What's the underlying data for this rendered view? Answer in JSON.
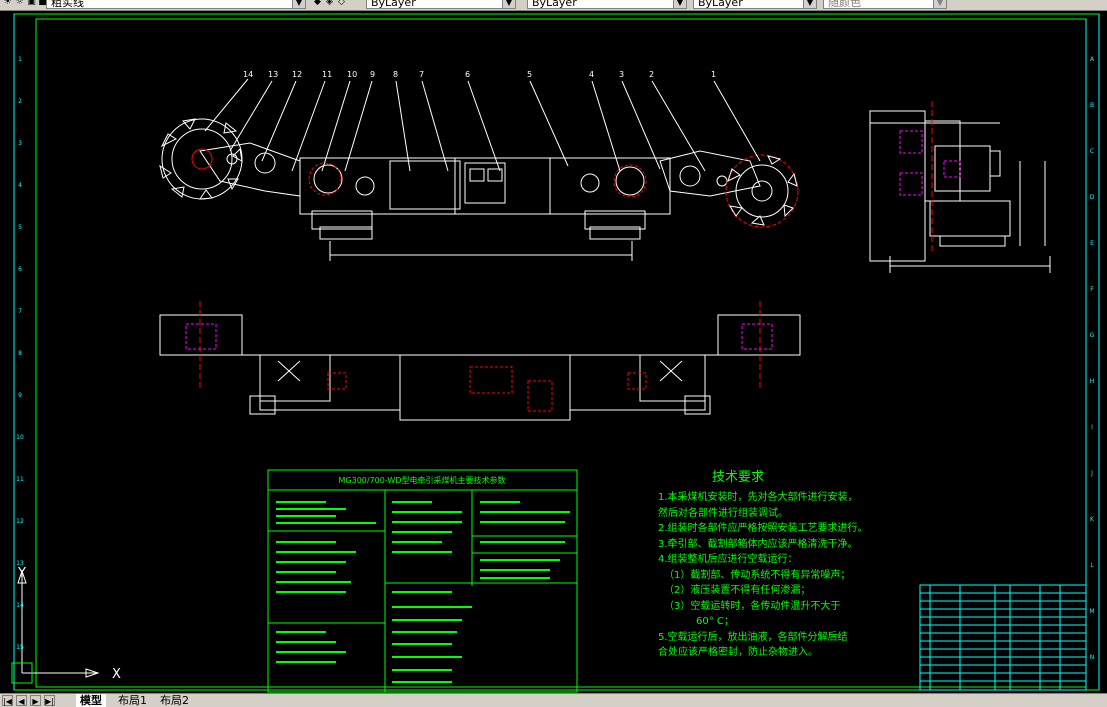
{
  "toolbar": {
    "layer_dropdown_value": "粗实线",
    "color_dropdown_value": "ByLayer",
    "linetype_dropdown_value": "ByLayer",
    "lineweight_dropdown_value": "ByLayer",
    "plotstyle_dropdown_value": "随颜色"
  },
  "drawing": {
    "balloon_numbers": [
      "14",
      "13",
      "12",
      "11",
      "10",
      "9",
      "8",
      "7",
      "6",
      "5",
      "4",
      "3",
      "2",
      "1"
    ],
    "param_table_title": "MG300/700-WD型电牵引采煤机主要技术参数",
    "tech_title": "技术要求",
    "tech_lines": [
      "1.本采煤机安装时，先对各大部件进行安装，",
      "然后对各部件进行组装调试。",
      "2.组装时各部件应严格按照安装工艺要求进行。",
      "3.牵引部、截割部箱体内应该严格清洗干净。",
      "4.组装整机后应进行空载运行：",
      "（1）截割部、传动系统不得有异常噪声；",
      "（2）液压装置不得有任何渗漏；",
      "（3）空载运转时，各传动件温升不大于",
      "60° C；",
      "5.空载运行后，放出油液，各部件分解后结",
      "合处应该严格密封，防止杂物进入。"
    ],
    "right_ruler_letters": [
      "A",
      "B",
      "C",
      "D",
      "E",
      "F",
      "G",
      "H",
      "I",
      "J",
      "K",
      "L",
      "M",
      "N"
    ],
    "left_ruler_numbers": [
      "1",
      "2",
      "3",
      "4",
      "5",
      "6",
      "7",
      "8",
      "9",
      "10",
      "11",
      "12",
      "13",
      "14",
      "15"
    ],
    "ucs_y": "Y",
    "ucs_x": "X"
  },
  "tabs": {
    "model": "模型",
    "layout1": "布局1",
    "layout2": "布局2"
  },
  "colors": {
    "background": "#000000",
    "line_white": "#ffffff",
    "line_green": "#00ff00",
    "line_red": "#ff0000",
    "line_cyan": "#00ffff",
    "line_magenta": "#ff00ff",
    "line_yellow": "#ffff00"
  }
}
